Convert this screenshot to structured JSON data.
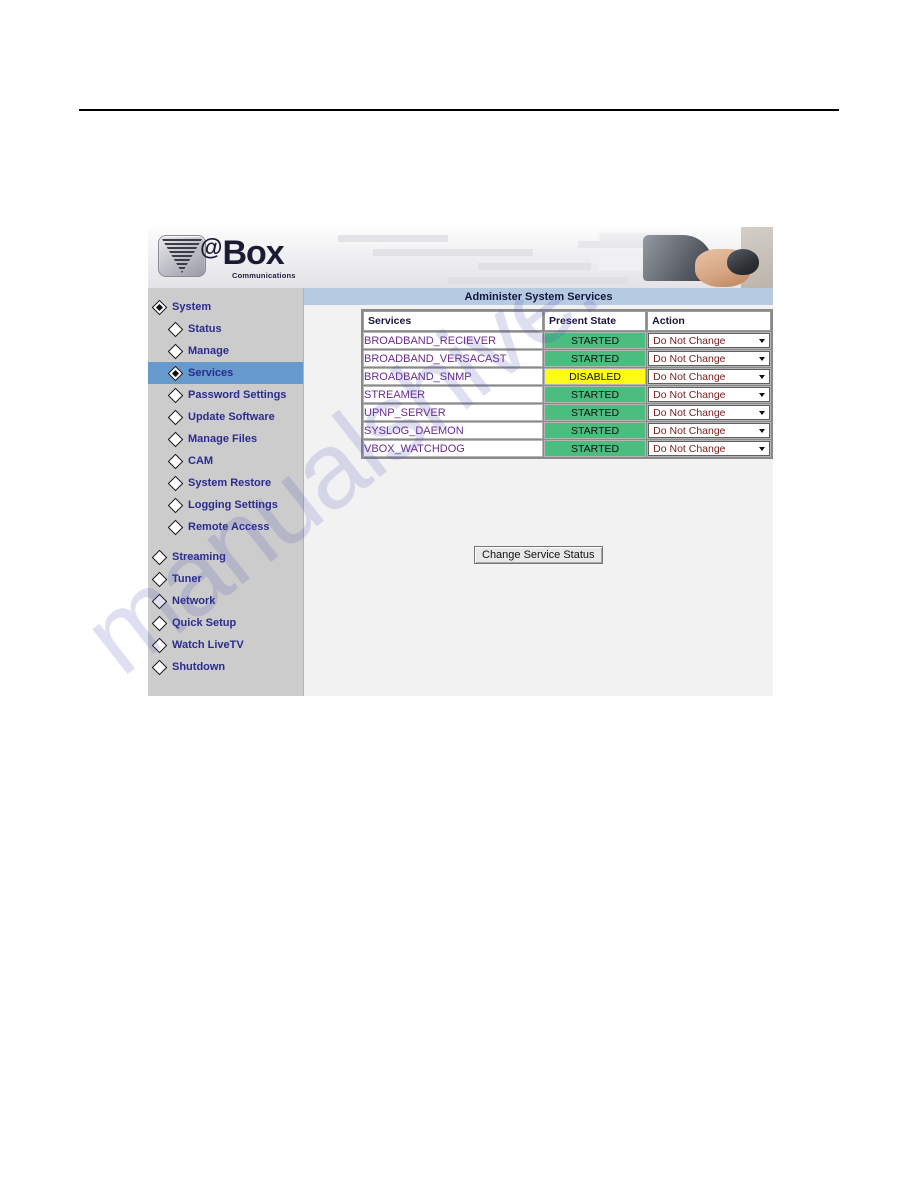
{
  "branding": {
    "logo_at": "@",
    "logo_box": "Box",
    "logo_subtitle": "Communications"
  },
  "sidebar": {
    "items": [
      {
        "label": "System",
        "level": 1,
        "marker": "filled",
        "selected": false
      },
      {
        "label": "Status",
        "level": 2,
        "marker": "hollow",
        "selected": false
      },
      {
        "label": "Manage",
        "level": 2,
        "marker": "hollow",
        "selected": false
      },
      {
        "label": "Services",
        "level": 2,
        "marker": "filled",
        "selected": true
      },
      {
        "label": "Password Settings",
        "level": 2,
        "marker": "hollow",
        "selected": false
      },
      {
        "label": "Update Software",
        "level": 2,
        "marker": "hollow",
        "selected": false
      },
      {
        "label": "Manage Files",
        "level": 2,
        "marker": "hollow",
        "selected": false
      },
      {
        "label": "CAM",
        "level": 2,
        "marker": "hollow",
        "selected": false
      },
      {
        "label": "System Restore",
        "level": 2,
        "marker": "hollow",
        "selected": false
      },
      {
        "label": "Logging Settings",
        "level": 2,
        "marker": "hollow",
        "selected": false
      },
      {
        "label": "Remote Access",
        "level": 2,
        "marker": "hollow",
        "selected": false
      },
      {
        "label": "Streaming",
        "level": 1,
        "marker": "hollow",
        "selected": false
      },
      {
        "label": "Tuner",
        "level": 1,
        "marker": "hollow",
        "selected": false
      },
      {
        "label": "Network",
        "level": 1,
        "marker": "hollow",
        "selected": false
      },
      {
        "label": "Quick Setup",
        "level": 1,
        "marker": "hollow",
        "selected": false
      },
      {
        "label": "Watch LiveTV",
        "level": 1,
        "marker": "hollow",
        "selected": false
      },
      {
        "label": "Shutdown",
        "level": 1,
        "marker": "hollow",
        "selected": false
      }
    ]
  },
  "content": {
    "title": "Administer System Services",
    "table": {
      "columns": [
        "Services",
        "Present State",
        "Action"
      ],
      "rows": [
        {
          "service": "BROADBAND_RECIEVER",
          "state": "STARTED",
          "state_kind": "started",
          "action": "Do Not Change"
        },
        {
          "service": "BROADBAND_VERSACAST",
          "state": "STARTED",
          "state_kind": "started",
          "action": "Do Not Change"
        },
        {
          "service": "BROADBAND_SNMP",
          "state": "DISABLED",
          "state_kind": "disabled",
          "action": "Do Not Change"
        },
        {
          "service": "STREAMER",
          "state": "STARTED",
          "state_kind": "started",
          "action": "Do Not Change"
        },
        {
          "service": "UPNP_SERVER",
          "state": "STARTED",
          "state_kind": "started",
          "action": "Do Not Change"
        },
        {
          "service": "SYSLOG_DAEMON",
          "state": "STARTED",
          "state_kind": "started",
          "action": "Do Not Change"
        },
        {
          "service": "VBOX_WATCHDOG",
          "state": "STARTED",
          "state_kind": "started",
          "action": "Do Not Change"
        }
      ]
    },
    "submit_label": "Change Service Status"
  },
  "watermark": {
    "text": "manualshive.com"
  },
  "colors": {
    "state_started": "#4bbd7e",
    "state_disabled": "#fbfb17",
    "sidebar_bg": "#cccccc",
    "sidebar_selected": "#6699cc",
    "title_bar": "#b6cbe2",
    "nav_text": "#2b2b8f",
    "service_text": "#6a2c8f",
    "dropdown_text": "#7a2020"
  }
}
